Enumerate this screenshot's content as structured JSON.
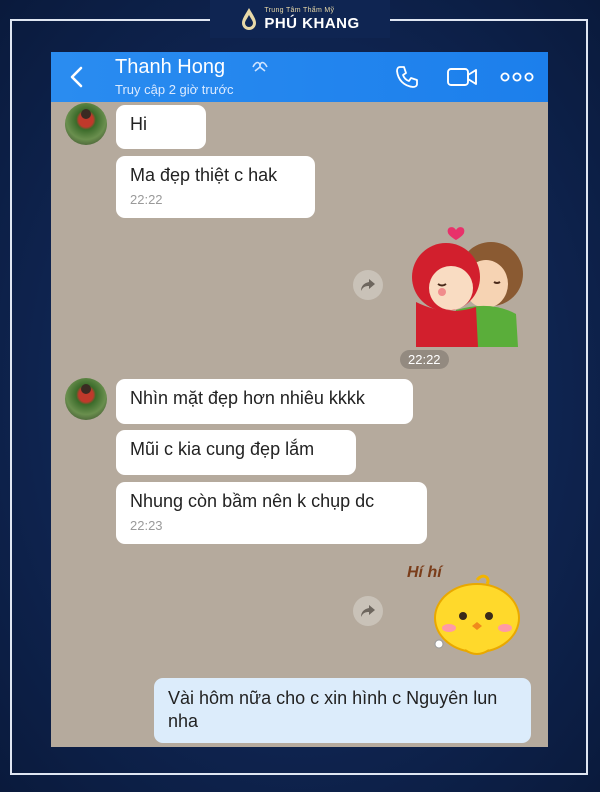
{
  "brand": {
    "top_line": "Trung Tâm Thẩm Mỹ",
    "name": "PHÚ KHANG"
  },
  "header": {
    "contact_name": "Thanh Hong",
    "status": "Truy cập 2 giờ trước"
  },
  "messages": {
    "m1": "Hi",
    "m2": "Ma đẹp thiệt c hak",
    "m2_time": "22:22",
    "sticker1_time": "22:22",
    "m3": "Nhìn mặt đẹp hơn nhiêu kkkk",
    "m4": "Mũi c kia cung đẹp lắm",
    "m5": "Nhung còn bầm nên k chụp dc",
    "m5_time": "22:23",
    "sticker2_text": "Hí hí",
    "m6": "Vài hôm nữa cho c xin hình c Nguyên lun nha"
  },
  "icons": [
    "back-icon",
    "verified-icon",
    "call-icon",
    "video-icon",
    "more-icon",
    "share-icon"
  ],
  "colors": {
    "header": "#1c7fec",
    "chat_bg": "#b5aa9d",
    "my_bubble": "#dcecfb"
  }
}
